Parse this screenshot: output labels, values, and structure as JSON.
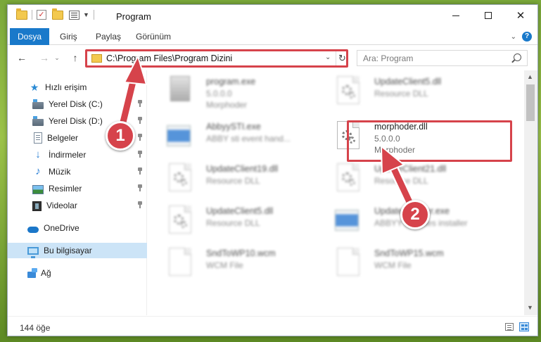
{
  "window": {
    "title": "Program",
    "status_count": "144 öğe"
  },
  "ribbon": {
    "tabs": [
      {
        "label": "Dosya"
      },
      {
        "label": "Giriş"
      },
      {
        "label": "Paylaş"
      },
      {
        "label": "Görünüm"
      }
    ],
    "help": "?"
  },
  "navigation": {
    "address": "C:\\Program Files\\Program Dizini",
    "search_placeholder": "Ara: Program"
  },
  "sidebar": {
    "items": [
      {
        "label": "Hızlı erişim",
        "icon": "quick-access-star-icon",
        "pinned": false
      },
      {
        "label": "Yerel Disk (C:)",
        "icon": "drive-icon",
        "pinned": true
      },
      {
        "label": "Yerel Disk (D:)",
        "icon": "drive-icon",
        "pinned": true
      },
      {
        "label": "Belgeler",
        "icon": "documents-icon",
        "pinned": true
      },
      {
        "label": "İndirmeler",
        "icon": "downloads-icon",
        "pinned": true
      },
      {
        "label": "Müzik",
        "icon": "music-icon",
        "pinned": true
      },
      {
        "label": "Resimler",
        "icon": "pictures-icon",
        "pinned": true
      },
      {
        "label": "Videolar",
        "icon": "videos-icon",
        "pinned": true
      },
      {
        "label": "OneDrive",
        "icon": "onedrive-icon",
        "pinned": false
      },
      {
        "label": "Bu bilgisayar",
        "icon": "this-pc-icon",
        "pinned": false,
        "selected": true
      },
      {
        "label": "Ağ",
        "icon": "network-icon",
        "pinned": false
      }
    ]
  },
  "files": [
    {
      "name": "program.exe",
      "line1": "5.0.0.0",
      "line2": "Morphoder",
      "icon": "app-icon",
      "blurred": true
    },
    {
      "name": "UpdateClient5.dll",
      "line1": "Resource DLL",
      "line2": "",
      "icon": "dll-icon",
      "blurred": true
    },
    {
      "name": "AbbyySTI.exe",
      "line1": "ABBY sti event hand...",
      "line2": "",
      "icon": "exe-icon",
      "blurred": true
    },
    {
      "name": "morphoder.dll",
      "line1": "5.0.0.0",
      "line2": "Morphoder",
      "icon": "dll-icon",
      "blurred": false
    },
    {
      "name": "UpdateClient19.dll",
      "line1": "Resource DLL",
      "line2": "",
      "icon": "dll-icon",
      "blurred": true
    },
    {
      "name": "UpdateClient21.dll",
      "line1": "Resource DLL",
      "line2": "",
      "icon": "dll-icon",
      "blurred": true
    },
    {
      "name": "UpdateClient5.dll",
      "line1": "Resource DLL",
      "line2": "",
      "icon": "dll-icon",
      "blurred": true
    },
    {
      "name": "UpdateInstaller.exe",
      "line1": "ABBYY Updates installer",
      "line2": "",
      "icon": "exe-icon",
      "blurred": true
    },
    {
      "name": "SndToWP10.wcm",
      "line1": "WCM File",
      "line2": "",
      "icon": "file-icon",
      "blurred": true
    },
    {
      "name": "SndToWP15.wcm",
      "line1": "WCM File",
      "line2": "",
      "icon": "file-icon",
      "blurred": true
    }
  ],
  "annotations": {
    "badge_1": "1",
    "badge_2": "2",
    "color": "#d6434b"
  }
}
